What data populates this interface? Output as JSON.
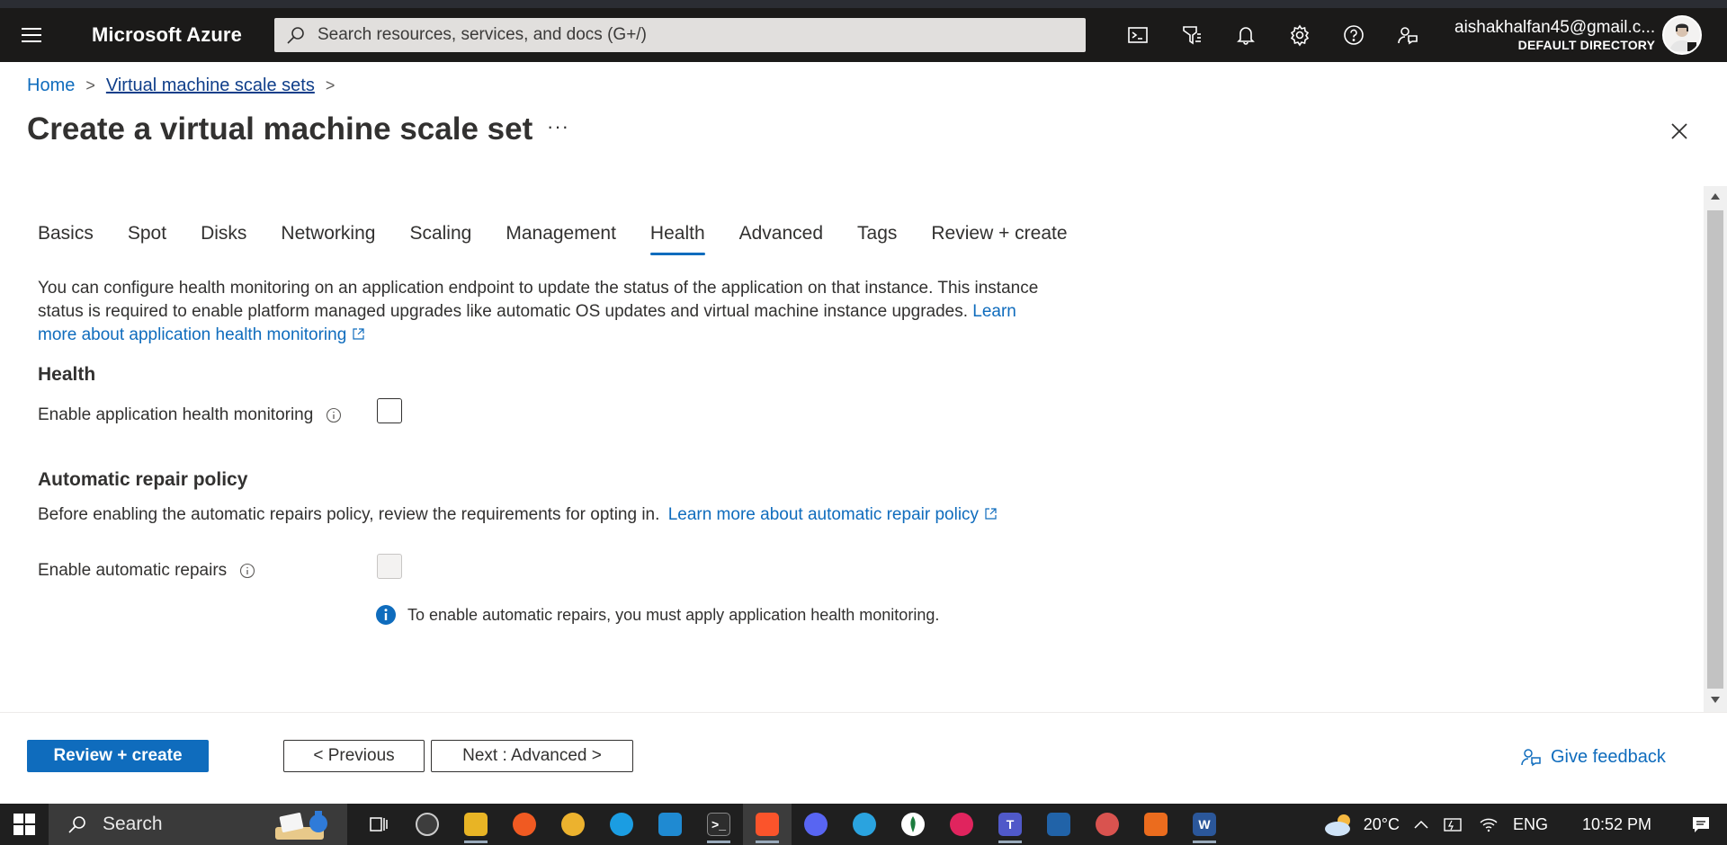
{
  "header": {
    "brand": "Microsoft Azure",
    "search_placeholder": "Search resources, services, and docs (G+/)",
    "account_email": "aishakhalfan45@gmail.c...",
    "account_directory": "DEFAULT DIRECTORY",
    "icons": [
      "cloud-shell-icon",
      "directory-filter-icon",
      "notifications-icon",
      "settings-icon",
      "help-icon",
      "feedback-icon"
    ]
  },
  "breadcrumb": {
    "home": "Home",
    "parent": "Virtual machine scale sets",
    "separator": ">"
  },
  "page": {
    "title": "Create a virtual machine scale set",
    "more": "···"
  },
  "tabs": [
    {
      "label": "Basics",
      "active": false
    },
    {
      "label": "Spot",
      "active": false
    },
    {
      "label": "Disks",
      "active": false
    },
    {
      "label": "Networking",
      "active": false
    },
    {
      "label": "Scaling",
      "active": false
    },
    {
      "label": "Management",
      "active": false
    },
    {
      "label": "Health",
      "active": true
    },
    {
      "label": "Advanced",
      "active": false
    },
    {
      "label": "Tags",
      "active": false
    },
    {
      "label": "Review + create",
      "active": false
    }
  ],
  "intro": {
    "text": "You can configure health monitoring on an application endpoint to update the status of the application on that instance. This instance status is required to enable platform managed upgrades like automatic OS updates and virtual machine instance upgrades.",
    "link": "Learn more about application health monitoring"
  },
  "health": {
    "heading": "Health",
    "enable_label": "Enable application health monitoring",
    "enabled": false
  },
  "repair": {
    "heading": "Automatic repair policy",
    "description": "Before enabling the automatic repairs policy, review the requirements for opting in.",
    "link": "Learn more about automatic repair policy",
    "enable_label": "Enable automatic repairs",
    "enabled": false,
    "disabled": true,
    "note": "To enable automatic repairs, you must apply application health monitoring."
  },
  "footer": {
    "review_create": "Review + create",
    "previous": "< Previous",
    "next": "Next : Advanced >",
    "feedback": "Give feedback"
  },
  "taskbar": {
    "search": "Search",
    "weather": "20°C",
    "language": "ENG",
    "time": "10:52 PM",
    "apps": [
      {
        "name": "task-view-icon",
        "color": "#2b2b2b"
      },
      {
        "name": "obs-icon",
        "color": "#444444"
      },
      {
        "name": "file-explorer-icon",
        "color": "#e8b425"
      },
      {
        "name": "figma-icon",
        "color": "#f05a22"
      },
      {
        "name": "slack-icon",
        "color": "#4a154b"
      },
      {
        "name": "edge-icon",
        "color": "#1b9de2"
      },
      {
        "name": "vscode-icon",
        "color": "#1f8ad2"
      },
      {
        "name": "terminal-icon",
        "color": "#2d2d2d"
      },
      {
        "name": "brave-icon",
        "color": "#fb542b"
      },
      {
        "name": "discord-icon",
        "color": "#5865f2"
      },
      {
        "name": "telegram-icon",
        "color": "#2aa3df"
      },
      {
        "name": "mongodb-compass-icon",
        "color": "#1c7c3e"
      },
      {
        "name": "media-player-icon",
        "color": "#e0245e"
      },
      {
        "name": "teams-icon",
        "color": "#5059c9"
      },
      {
        "name": "virtualbox-icon",
        "color": "#2163a8"
      },
      {
        "name": "paint-icon",
        "color": "#d9534f"
      },
      {
        "name": "office-icon",
        "color": "#eb6c1e"
      },
      {
        "name": "word-icon",
        "color": "#2b579a"
      }
    ]
  },
  "colors": {
    "accent": "#0f6cbd",
    "header_bg": "#1b1a19",
    "taskbar_bg": "#1f1f1f"
  }
}
